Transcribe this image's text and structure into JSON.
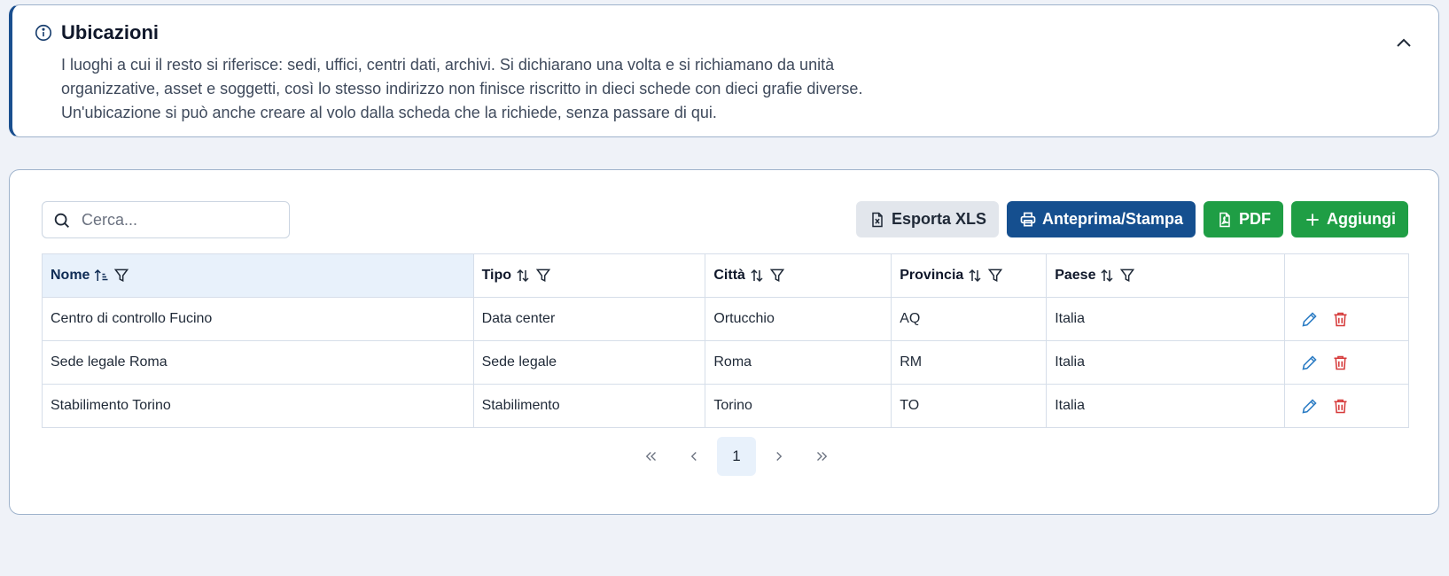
{
  "info": {
    "title": "Ubicazioni",
    "lines": [
      "I luoghi a cui il resto si riferisce: sedi, uffici, centri dati, archivi. Si dichiarano una volta e si richiamano da unità",
      "organizzative, asset e soggetti, così lo stesso indirizzo non finisce riscritto in dieci schede con dieci grafie diverse.",
      "Un'ubicazione si può anche creare al volo dalla scheda che la richiede, senza passare di qui."
    ]
  },
  "search": {
    "placeholder": "Cerca..."
  },
  "toolbar": {
    "xls_label": "Esporta XLS",
    "print_label": "Anteprima/Stampa",
    "pdf_label": "PDF",
    "add_label": "Aggiungi"
  },
  "table": {
    "columns": [
      "Nome",
      "Tipo",
      "Città",
      "Provincia",
      "Paese"
    ],
    "rows": [
      [
        "Centro di controllo Fucino",
        "Data center",
        "Ortucchio",
        "AQ",
        "Italia"
      ],
      [
        "Sede legale Roma",
        "Sede legale",
        "Roma",
        "RM",
        "Italia"
      ],
      [
        "Stabilimento Torino",
        "Stabilimento",
        "Torino",
        "TO",
        "Italia"
      ]
    ]
  },
  "pagination": {
    "current": "1"
  },
  "colors": {
    "accent": "#1a4f8f",
    "print": "#154f8f",
    "green": "#1f9e45",
    "edit": "#2b7cc4",
    "delete": "#d63b3b"
  }
}
